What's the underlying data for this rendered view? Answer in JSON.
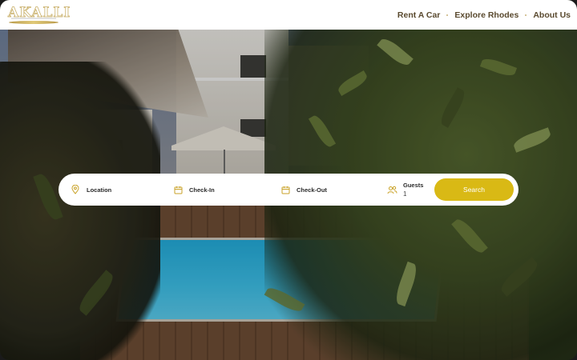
{
  "header": {
    "logo_text": "AKALLI",
    "nav": [
      {
        "label": "Rent A Car"
      },
      {
        "label": "Explore Rhodes"
      },
      {
        "label": "About Us"
      }
    ]
  },
  "search": {
    "location_label": "Location",
    "checkin_label": "Check-In",
    "checkout_label": "Check-Out",
    "guests_label": "Guests",
    "guests_value": "1",
    "button_label": "Search"
  },
  "colors": {
    "accent": "#d9b915",
    "nav_text": "#5a4a2f",
    "icon_gold": "#c9a227"
  },
  "icons": {
    "location": "map-pin-icon",
    "checkin": "calendar-icon",
    "checkout": "calendar-icon",
    "guests": "users-icon"
  }
}
